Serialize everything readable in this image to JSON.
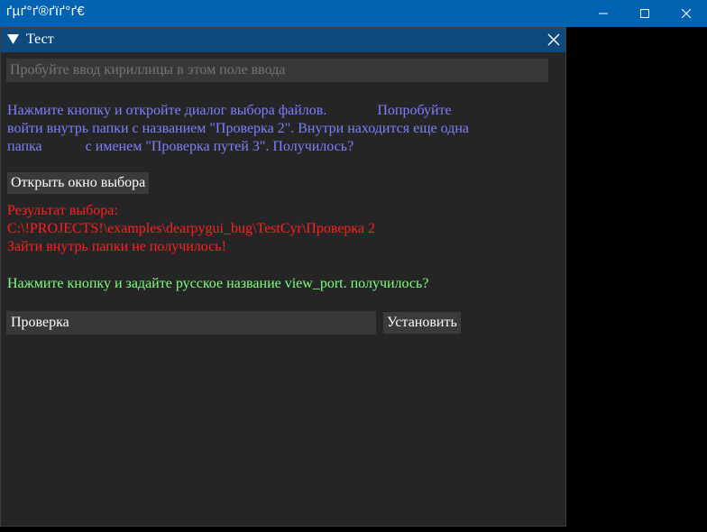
{
  "os_window": {
    "title": "ґµґ°ґ®ґїґ°ґ€"
  },
  "window": {
    "title": "Тест"
  },
  "search": {
    "placeholder": "Пробуйте ввод кириллицы в этом поле ввода"
  },
  "instructions": {
    "line1": "Нажмите кнопку и откройте диалог выбора файлов.              Попробуйте",
    "line2": "войти внутрь папки с названием \"Проверка 2\". Внутри находится еще одна",
    "line3": "папка            с именем \"Проверка путей 3\". Получилось?"
  },
  "open_button": {
    "label": "Открыть окно выбора"
  },
  "result": {
    "label": "Результат выбора:",
    "path": "C:\\!PROJECTS!\\examples\\dearpygui_bug\\TestCyr\\Проверка 2",
    "error": "Зайти внутрь папки не получилось!"
  },
  "viewport_prompt": {
    "text": "Нажмите кнопку и задайте русское название view_port. получилось?"
  },
  "viewport_name": {
    "value": "Проверка"
  },
  "set_button": {
    "label": "Установить"
  },
  "colors": {
    "os_titlebar": "#0063b1",
    "window_titlebar": "#0e4a7d",
    "window_bg": "#252526",
    "input_bg": "#38383b",
    "purple_text": "#7f7fff",
    "red_text": "#ff2020",
    "green_text": "#80ff80"
  },
  "icons": {
    "collapse": "triangle-down-icon",
    "window_close": "close-icon",
    "os_minimize": "minimize-icon",
    "os_maximize": "maximize-icon",
    "os_close": "close-icon"
  }
}
